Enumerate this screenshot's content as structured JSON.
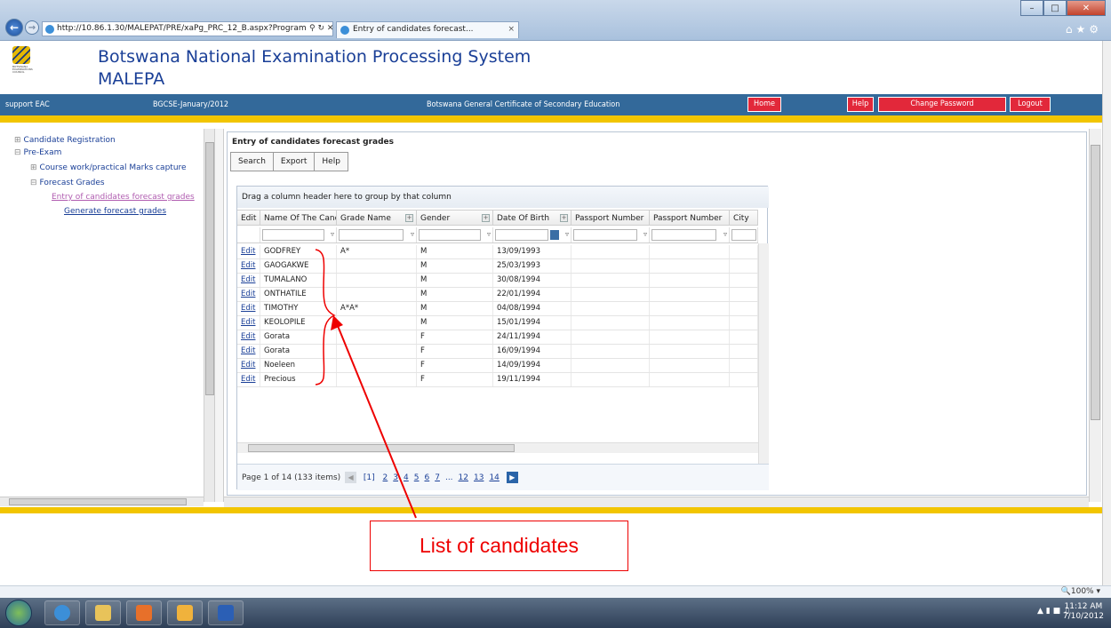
{
  "browser": {
    "url": "http://10.86.1.30/MALEPAT/PRE/xaPg_PRC_12_B.aspx?Program",
    "tab_title": "Entry of candidates forecast...",
    "tab_close": "×"
  },
  "header": {
    "title_line1": "Botswana National Examination Processing System",
    "title_line2": "MALEPA",
    "logo_text": "BOTSWANA EXAMINATIONS COUNCIL"
  },
  "bar": {
    "user": "support EAC",
    "session": "BGCSE-January/2012",
    "program": "Botswana General Certificate of Secondary Education",
    "home": "Home",
    "help": "Help",
    "change_password": "Change Password",
    "logout": "Logout"
  },
  "tree": {
    "candidate_registration": "Candidate Registration",
    "pre_exam": "Pre-Exam",
    "course_work": "Course work/practical Marks capture",
    "forecast_grades": "Forecast Grades",
    "entry": "Entry of candidates forecast grades",
    "generate": "Generate forecast grades"
  },
  "panel": {
    "title": "Entry of candidates forecast grades",
    "toolbar": [
      "Search",
      "Export",
      "Help"
    ]
  },
  "grid": {
    "group_hint": "Drag a column header here to group by that column",
    "columns": [
      "Edit",
      "Name Of The Cand",
      "Grade Name",
      "Gender",
      "Date Of Birth",
      "Passport Number",
      "Passport Number",
      "City"
    ],
    "rows": [
      {
        "edit": "Edit",
        "name": "GODFREY",
        "grade": "A*",
        "gender": "M",
        "dob": "13/09/1993"
      },
      {
        "edit": "Edit",
        "name": "GAOGAKWE",
        "grade": "",
        "gender": "M",
        "dob": "25/03/1993"
      },
      {
        "edit": "Edit",
        "name": "TUMALANO",
        "grade": "",
        "gender": "M",
        "dob": "30/08/1994"
      },
      {
        "edit": "Edit",
        "name": "ONTHATILE",
        "grade": "",
        "gender": "M",
        "dob": "22/01/1994"
      },
      {
        "edit": "Edit",
        "name": "TIMOTHY",
        "grade": "A*A*",
        "gender": "M",
        "dob": "04/08/1994"
      },
      {
        "edit": "Edit",
        "name": "KEOLOPILE",
        "grade": "",
        "gender": "M",
        "dob": "15/01/1994"
      },
      {
        "edit": "Edit",
        "name": "Gorata",
        "grade": "",
        "gender": "F",
        "dob": "24/11/1994"
      },
      {
        "edit": "Edit",
        "name": "Gorata",
        "grade": "",
        "gender": "F",
        "dob": "16/09/1994"
      },
      {
        "edit": "Edit",
        "name": "Noeleen",
        "grade": "",
        "gender": "F",
        "dob": "14/09/1994"
      },
      {
        "edit": "Edit",
        "name": "Precious",
        "grade": "",
        "gender": "F",
        "dob": "19/11/1994"
      }
    ],
    "pager": {
      "summary": "Page 1 of 14 (133 items)",
      "current": "[1]",
      "pages": [
        "2",
        "3",
        "4",
        "5",
        "6",
        "7",
        "...",
        "12",
        "13",
        "14"
      ]
    }
  },
  "annotation": {
    "label": "List of candidates",
    "color": "#ee0000"
  },
  "status": {
    "zoom": "100%"
  },
  "clock": {
    "time": "11:12 AM",
    "date": "7/10/2012"
  },
  "colors": {
    "bar": "#33699a",
    "accent_yellow": "#f2c500",
    "button_red": "#e2283a",
    "title_blue": "#1a3f97"
  }
}
